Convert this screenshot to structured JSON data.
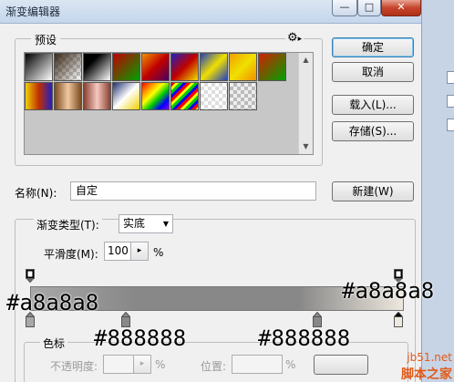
{
  "window": {
    "title": "渐变编辑器",
    "controls": {
      "minimize": "—",
      "maximize": "□",
      "close": "✕"
    }
  },
  "presets": {
    "label": "预设",
    "menu_icon": "gear-icon",
    "swatch_count": 17
  },
  "buttons": {
    "ok": "确定",
    "cancel": "取消",
    "load": "载入(L)...",
    "save": "存储(S)...",
    "new": "新建(W)"
  },
  "name_field": {
    "label": "名称(N):",
    "value": "自定"
  },
  "gradient_type": {
    "label": "渐变类型(T):",
    "value": "实底"
  },
  "smoothness": {
    "label": "平滑度(M):",
    "value": "100",
    "unit": "%"
  },
  "color_stops_group": {
    "label": "色标",
    "opacity_label": "不透明度:",
    "opacity_unit": "%",
    "location_label": "位置:",
    "location_unit": "%"
  },
  "captions": {
    "left": "#a8a8a8",
    "right": "#a8a8a8",
    "stop_mid_left": "#888888",
    "stop_mid_right": "#888888"
  },
  "gradient_colors": {
    "start": "#a8a8a8",
    "mid": "#888888",
    "end": "#ede7dd"
  },
  "watermark": {
    "site": "jb51.net",
    "brand": "脚本之家"
  }
}
